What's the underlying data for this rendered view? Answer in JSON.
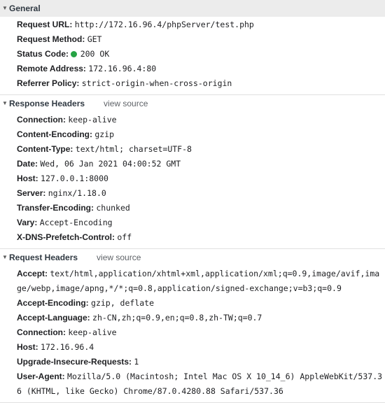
{
  "general": {
    "title": "General",
    "request_url": {
      "name": "Request URL:",
      "value": "http://172.16.96.4/phpServer/test.php"
    },
    "request_method": {
      "name": "Request Method:",
      "value": "GET"
    },
    "status_code": {
      "name": "Status Code:",
      "value": "200 OK",
      "dot_color": "#26a344"
    },
    "remote_address": {
      "name": "Remote Address:",
      "value": "172.16.96.4:80"
    },
    "referrer_policy": {
      "name": "Referrer Policy:",
      "value": "strict-origin-when-cross-origin"
    }
  },
  "response_headers": {
    "title": "Response Headers",
    "view_source": "view source",
    "rows": [
      {
        "name": "Connection:",
        "value": "keep-alive"
      },
      {
        "name": "Content-Encoding:",
        "value": "gzip"
      },
      {
        "name": "Content-Type:",
        "value": "text/html; charset=UTF-8"
      },
      {
        "name": "Date:",
        "value": "Wed, 06 Jan 2021 04:00:52 GMT"
      },
      {
        "name": "Host:",
        "value": "127.0.0.1:8000"
      },
      {
        "name": "Server:",
        "value": "nginx/1.18.0"
      },
      {
        "name": "Transfer-Encoding:",
        "value": "chunked"
      },
      {
        "name": "Vary:",
        "value": "Accept-Encoding"
      },
      {
        "name": "X-DNS-Prefetch-Control:",
        "value": "off"
      }
    ]
  },
  "request_headers": {
    "title": "Request Headers",
    "view_source": "view source",
    "rows": [
      {
        "name": "Accept:",
        "value": "text/html,application/xhtml+xml,application/xml;q=0.9,image/avif,image/webp,image/apng,*/*;q=0.8,application/signed-exchange;v=b3;q=0.9"
      },
      {
        "name": "Accept-Encoding:",
        "value": "gzip, deflate"
      },
      {
        "name": "Accept-Language:",
        "value": "zh-CN,zh;q=0.9,en;q=0.8,zh-TW;q=0.7"
      },
      {
        "name": "Connection:",
        "value": "keep-alive"
      },
      {
        "name": "Host:",
        "value": "172.16.96.4"
      },
      {
        "name": "Upgrade-Insecure-Requests:",
        "value": "1"
      },
      {
        "name": "User-Agent:",
        "value": "Mozilla/5.0 (Macintosh; Intel Mac OS X 10_14_6) AppleWebKit/537.36 (KHTML, like Gecko) Chrome/87.0.4280.88 Safari/537.36"
      }
    ]
  }
}
